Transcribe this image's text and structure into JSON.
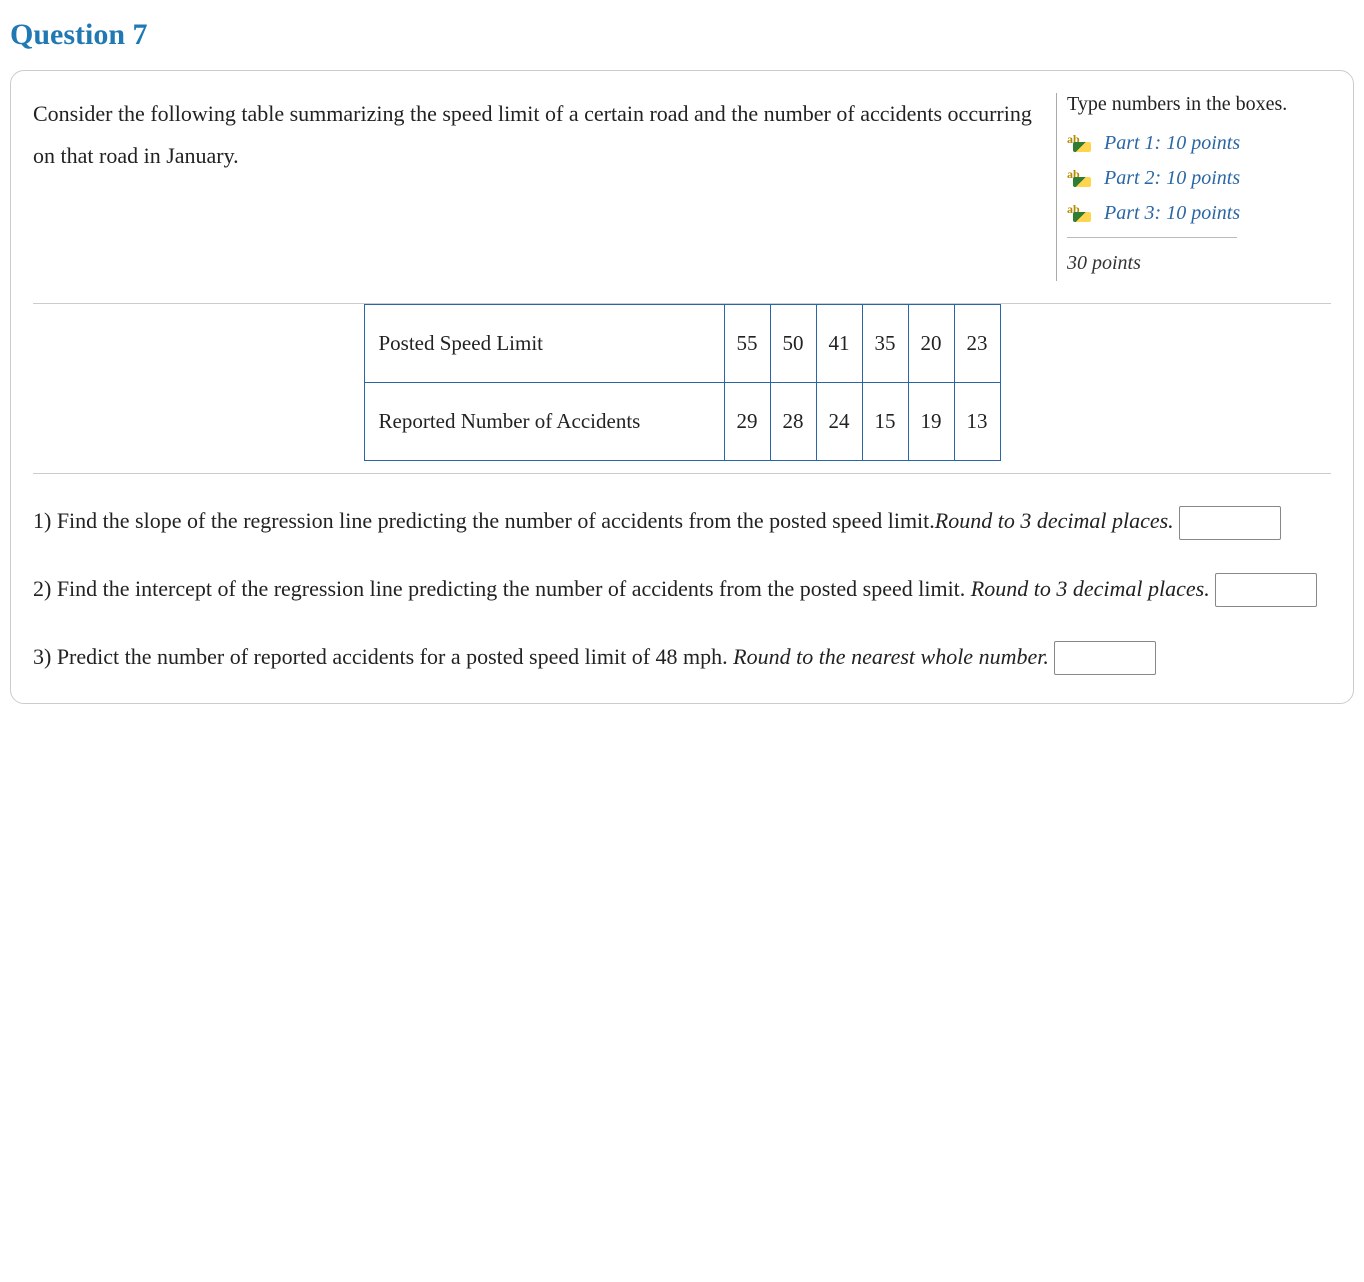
{
  "title": "Question 7",
  "intro": "Consider the following table summarizing the speed limit of a certain road and the number of accidents occurring on that road in January.",
  "points": {
    "hint": "Type numbers in the boxes.",
    "parts": [
      {
        "label": "Part 1: 10 points"
      },
      {
        "label": "Part 2: 10 points"
      },
      {
        "label": "Part 3: 10 points"
      }
    ],
    "total": "30 points"
  },
  "table": {
    "rows": [
      {
        "label": "Posted Speed Limit",
        "values": [
          "55",
          "50",
          "41",
          "35",
          "20",
          "23"
        ]
      },
      {
        "label": "Reported Number of Accidents",
        "values": [
          "29",
          "28",
          "24",
          "15",
          "19",
          "13"
        ]
      }
    ]
  },
  "parts": {
    "p1_a": "1) Find the slope of the regression line predicting the number of accidents from the posted speed limit.",
    "p1_b": "Round to 3 decimal places.",
    "p2_a": "2) Find the intercept of the regression line predicting the number of accidents from the posted speed limit. ",
    "p2_b": "Round to 3 decimal places.",
    "p3_a": "3) Predict the number of reported accidents for a posted speed limit of 48 mph. ",
    "p3_b": "Round to the nearest whole number."
  }
}
